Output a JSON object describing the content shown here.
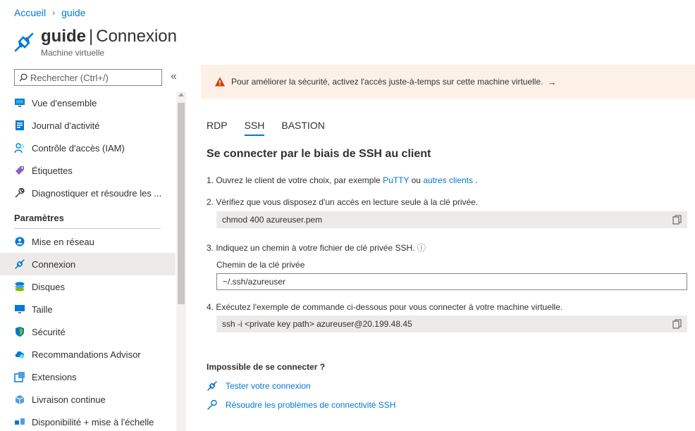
{
  "breadcrumb": {
    "home": "Accueil",
    "separator": "›",
    "current": "guide"
  },
  "header": {
    "resource_name": "guide",
    "separator": "|",
    "page_name": "Connexion",
    "subtitle": "Machine virtuelle",
    "icon": "plug-connect-icon",
    "icon_color": "#0078d4"
  },
  "search": {
    "placeholder": "Rechercher (Ctrl+/)",
    "collapse_label": "«"
  },
  "sidebar": {
    "items_top": [
      {
        "label": "Vue d'ensemble",
        "icon": "monitor-icon"
      },
      {
        "label": "Journal d'activité",
        "icon": "activity-log-icon"
      },
      {
        "label": "Contrôle d'accès (IAM)",
        "icon": "people-icon"
      },
      {
        "label": "Étiquettes",
        "icon": "tag-icon"
      },
      {
        "label": "Diagnostiquer et résoudre les ...",
        "icon": "wrench-icon"
      }
    ],
    "section_title": "Paramètres",
    "items_settings": [
      {
        "label": "Mise en réseau",
        "icon": "network-icon"
      },
      {
        "label": "Connexion",
        "icon": "plug-connect-icon",
        "active": true
      },
      {
        "label": "Disques",
        "icon": "disks-icon"
      },
      {
        "label": "Taille",
        "icon": "monitor-icon"
      },
      {
        "label": "Sécurité",
        "icon": "shield-icon"
      },
      {
        "label": "Recommandations Advisor",
        "icon": "advisor-icon"
      },
      {
        "label": "Extensions",
        "icon": "extensions-icon"
      },
      {
        "label": "Livraison continue",
        "icon": "delivery-icon"
      },
      {
        "label": "Disponibilité + mise à l'échelle",
        "icon": "scale-icon"
      }
    ]
  },
  "banner": {
    "text": "Pour améliorer la sécurité, activez l'accès juste-à-temps sur cette machine virtuelle.",
    "arrow": "→",
    "icon": "warning-icon",
    "icon_color": "#d83b01"
  },
  "tabs": [
    {
      "label": "RDP",
      "active": false
    },
    {
      "label": "SSH",
      "active": true
    },
    {
      "label": "BASTION",
      "active": false
    }
  ],
  "main": {
    "title": "Se connecter par le biais de SSH au client",
    "step1": {
      "prefix": "1. Ouvrez le client de votre choix, par exemple",
      "link1": "PuTTY",
      "middle": "ou",
      "link2": "autres clients",
      "suffix": "."
    },
    "step2": {
      "text": "2. Vérifiez que vous disposez d'un accès en lecture seule à la clé privée.",
      "command": "chmod 400 azureuser.pem"
    },
    "step3": {
      "text": "3. Indiquez un chemin à votre fichier de clé privée SSH.",
      "info_glyph": "ⓘ",
      "field_label": "Chemin de la clé privée",
      "field_value": "~/.ssh/azureuser"
    },
    "step4": {
      "text": "4. Exécutez l'exemple de commande ci-dessous pour vous connecter à votre machine virtuelle.",
      "command": "ssh -i <private key path> azureuser@20.199.48.45"
    }
  },
  "help": {
    "title": "Impossible de se connecter ?",
    "test_link": "Tester votre connexion",
    "troubleshoot_link": "Résoudre les problèmes de connectivité SSH"
  },
  "colors": {
    "accent": "#0078d4",
    "banner_bg": "#fdf1e7",
    "active_nav_bg": "#edebe9"
  }
}
